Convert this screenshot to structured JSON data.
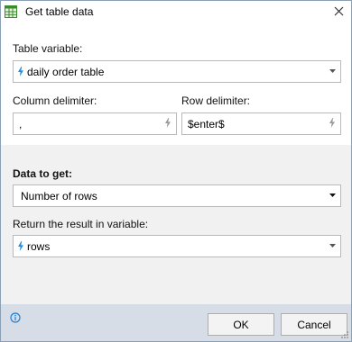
{
  "window": {
    "title": "Get table data",
    "title_icon": "table-icon",
    "close_icon": "close-icon"
  },
  "table_variable": {
    "label": "Table variable:",
    "value": "daily order table"
  },
  "column_delimiter": {
    "label": "Column delimiter:",
    "value": ","
  },
  "row_delimiter": {
    "label": "Row delimiter:",
    "value": "$enter$"
  },
  "data_to_get": {
    "label": "Data to get:",
    "value": "Number of rows"
  },
  "return_variable": {
    "label": "Return the result in variable:",
    "value": "rows"
  },
  "footer": {
    "info_icon": "info-icon",
    "ok_label": "OK",
    "cancel_label": "Cancel"
  },
  "colors": {
    "variable_bolt": "#1e8ee6",
    "ghost_bolt": "#9a9a9a",
    "footer_bg": "#d6dde6"
  }
}
